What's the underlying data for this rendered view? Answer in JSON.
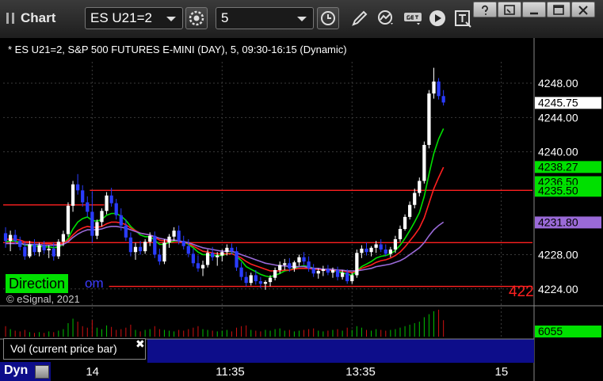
{
  "window": {
    "title": "Chart",
    "symbol": "ES U21=2",
    "interval": "5",
    "controls": [
      "settings-icon",
      "interval-clock-icon",
      "draw-pencil-icon",
      "study-icon",
      "get-data-icon",
      "play-icon",
      "annotation-icon"
    ],
    "window_buttons": [
      "help-icon",
      "restore-icon",
      "minimize-icon",
      "maximize-icon",
      "close-icon"
    ]
  },
  "chart_header": "* ES U21=2, S&P 500 FUTURES E-MINI (DAY), 5, 09:30-16:15 (Dynamic)",
  "overlay": {
    "direction_label": "Direction",
    "direction_tail": "om",
    "copyright": "© eSignal, 2021",
    "right_partial": "422"
  },
  "colors": {
    "background": "#000000",
    "grid": "#3a3a3a",
    "up_candle": "#ffffff",
    "down_candle": "#2a3cff",
    "reference_line": "#ff2020",
    "fast_ma": "#00e000",
    "slow_ma": "#ff2020",
    "vwap_ma": "#9a6ad8",
    "volume_panel": "#0d0d8a",
    "price_tag_green": "#00e000",
    "price_tag_purple": "#9a6ad8"
  },
  "chart_data": {
    "type": "candlestick",
    "y_axis": {
      "ylim": [
        4222.5,
        4250.5
      ],
      "ticks": [
        "4248.00",
        "4244.00",
        "4240.00",
        "4228.00",
        "4224.00"
      ],
      "price_tags": [
        {
          "label": "4245.75",
          "value": 4245.75,
          "style": "white"
        },
        {
          "label": "4238.27",
          "value": 4238.27,
          "style": "green"
        },
        {
          "label": "4236.50",
          "value": 4236.5,
          "style": "green"
        },
        {
          "label": "4235.50",
          "value": 4235.5,
          "style": "green"
        },
        {
          "label": "4231.80",
          "value": 4231.8,
          "style": "purple"
        }
      ]
    },
    "x_axis": {
      "labels": [
        "14",
        "11:35",
        "13:35",
        "15"
      ],
      "label_index": [
        18,
        45,
        72,
        103
      ]
    },
    "reference_lines": [
      {
        "value": 4235.5,
        "from_index": 18,
        "to_index": 110
      },
      {
        "value": 4233.8,
        "from_index": 0,
        "to_index": 21
      },
      {
        "value": 4229.4,
        "from_index": 0,
        "to_index": 110
      },
      {
        "value": 4224.3,
        "from_index": 22,
        "to_index": 110
      }
    ],
    "bar_count": 110,
    "candles": [
      [
        4230.5,
        4231.2,
        4228.8,
        4229.6
      ],
      [
        4229.6,
        4230.8,
        4228.4,
        4230.3
      ],
      [
        4230.3,
        4230.9,
        4229.2,
        4229.6
      ],
      [
        4229.6,
        4230.1,
        4228.5,
        4228.9
      ],
      [
        4228.9,
        4229.5,
        4227.4,
        4227.8
      ],
      [
        4227.8,
        4229.6,
        4227.6,
        4229.2
      ],
      [
        4229.2,
        4229.8,
        4227.9,
        4228.3
      ],
      [
        4228.3,
        4229.4,
        4227.8,
        4229.1
      ],
      [
        4229.1,
        4229.6,
        4228.1,
        4228.5
      ],
      [
        4228.5,
        4229.1,
        4227.6,
        4228.7
      ],
      [
        4228.7,
        4229.4,
        4227.3,
        4227.8
      ],
      [
        4227.8,
        4229.8,
        4227.5,
        4229.5
      ],
      [
        4229.5,
        4230.8,
        4229.0,
        4230.4
      ],
      [
        4230.4,
        4234.1,
        4230.1,
        4233.7
      ],
      [
        4233.7,
        4236.6,
        4233.0,
        4236.2
      ],
      [
        4236.2,
        4237.4,
        4235.0,
        4235.5
      ],
      [
        4235.5,
        4236.1,
        4233.6,
        4234.1
      ],
      [
        4234.1,
        4234.8,
        4232.4,
        4233.0
      ],
      [
        4233.0,
        4235.4,
        4229.4,
        4230.2
      ],
      [
        4230.2,
        4232.1,
        4229.8,
        4231.8
      ],
      [
        4231.8,
        4233.4,
        4231.3,
        4233.1
      ],
      [
        4233.1,
        4235.3,
        4232.7,
        4234.9
      ],
      [
        4234.9,
        4235.8,
        4233.6,
        4234.0
      ],
      [
        4234.0,
        4234.5,
        4232.1,
        4232.6
      ],
      [
        4232.6,
        4233.4,
        4230.8,
        4231.4
      ],
      [
        4231.4,
        4232.1,
        4229.6,
        4230.0
      ],
      [
        4230.0,
        4230.6,
        4227.8,
        4228.3
      ],
      [
        4228.3,
        4229.4,
        4227.4,
        4228.9
      ],
      [
        4228.9,
        4229.6,
        4228.0,
        4228.4
      ],
      [
        4228.4,
        4229.8,
        4228.1,
        4229.5
      ],
      [
        4229.5,
        4230.6,
        4229.0,
        4230.2
      ],
      [
        4230.2,
        4230.7,
        4227.6,
        4228.0
      ],
      [
        4228.0,
        4228.7,
        4226.8,
        4227.2
      ],
      [
        4227.2,
        4229.8,
        4226.9,
        4229.4
      ],
      [
        4229.4,
        4230.4,
        4228.8,
        4230.1
      ],
      [
        4230.1,
        4231.2,
        4229.6,
        4230.8
      ],
      [
        4230.8,
        4231.4,
        4229.2,
        4229.6
      ],
      [
        4229.6,
        4230.2,
        4228.6,
        4229.0
      ],
      [
        4229.0,
        4229.8,
        4227.7,
        4228.1
      ],
      [
        4228.1,
        4228.7,
        4226.6,
        4227.0
      ],
      [
        4227.0,
        4227.9,
        4226.0,
        4226.4
      ],
      [
        4226.4,
        4227.3,
        4225.5,
        4226.8
      ],
      [
        4226.8,
        4228.6,
        4226.5,
        4228.2
      ],
      [
        4228.2,
        4228.9,
        4227.3,
        4227.7
      ],
      [
        4227.7,
        4228.3,
        4226.7,
        4227.9
      ],
      [
        4227.9,
        4228.6,
        4227.2,
        4228.3
      ],
      [
        4228.3,
        4229.2,
        4227.9,
        4228.8
      ],
      [
        4228.8,
        4229.3,
        4228.0,
        4228.4
      ],
      [
        4228.4,
        4228.9,
        4226.1,
        4226.5
      ],
      [
        4226.5,
        4227.1,
        4225.0,
        4225.4
      ],
      [
        4225.4,
        4226.0,
        4224.3,
        4224.7
      ],
      [
        4224.7,
        4225.9,
        4224.4,
        4225.6
      ],
      [
        4225.6,
        4226.2,
        4224.5,
        4224.9
      ],
      [
        4224.9,
        4225.4,
        4224.1,
        4224.6
      ],
      [
        4224.6,
        4225.0,
        4223.9,
        4224.8
      ],
      [
        4224.8,
        4225.6,
        4224.3,
        4225.3
      ],
      [
        4225.3,
        4226.5,
        4225.0,
        4226.2
      ],
      [
        4226.2,
        4227.2,
        4225.8,
        4226.8
      ],
      [
        4226.8,
        4227.5,
        4226.2,
        4227.0
      ],
      [
        4227.0,
        4227.6,
        4226.0,
        4226.4
      ],
      [
        4226.4,
        4227.3,
        4226.0,
        4227.1
      ],
      [
        4227.1,
        4228.0,
        4226.7,
        4227.7
      ],
      [
        4227.7,
        4228.3,
        4226.8,
        4227.2
      ],
      [
        4227.2,
        4227.8,
        4226.0,
        4226.4
      ],
      [
        4226.4,
        4226.9,
        4225.4,
        4225.8
      ],
      [
        4225.8,
        4226.4,
        4225.2,
        4226.1
      ],
      [
        4226.1,
        4226.7,
        4225.5,
        4226.3
      ],
      [
        4226.3,
        4226.8,
        4225.6,
        4225.9
      ],
      [
        4225.9,
        4226.5,
        4225.3,
        4226.2
      ],
      [
        4226.2,
        4226.6,
        4225.0,
        4225.4
      ],
      [
        4225.4,
        4226.2,
        4225.1,
        4225.9
      ],
      [
        4225.9,
        4226.3,
        4224.6,
        4224.9
      ],
      [
        4224.9,
        4225.9,
        4224.6,
        4225.6
      ],
      [
        4225.6,
        4228.6,
        4225.3,
        4228.2
      ],
      [
        4228.2,
        4229.1,
        4227.6,
        4228.7
      ],
      [
        4228.7,
        4229.4,
        4227.9,
        4228.3
      ],
      [
        4228.3,
        4229.0,
        4227.8,
        4228.8
      ],
      [
        4228.8,
        4229.6,
        4228.2,
        4229.2
      ],
      [
        4229.2,
        4229.8,
        4228.3,
        4228.6
      ],
      [
        4228.6,
        4229.2,
        4227.8,
        4228.1
      ],
      [
        4228.1,
        4228.9,
        4227.7,
        4228.6
      ],
      [
        4228.6,
        4230.2,
        4228.2,
        4229.8
      ],
      [
        4229.8,
        4231.4,
        4229.5,
        4231.0
      ],
      [
        4231.0,
        4232.7,
        4230.8,
        4232.4
      ],
      [
        4232.4,
        4234.2,
        4232.1,
        4233.8
      ],
      [
        4233.8,
        4235.7,
        4233.4,
        4235.2
      ],
      [
        4235.2,
        4237.0,
        4234.8,
        4236.6
      ],
      [
        4236.6,
        4241.2,
        4236.3,
        4240.8
      ],
      [
        4240.8,
        4247.2,
        4240.4,
        4246.8
      ],
      [
        4246.8,
        4249.8,
        4246.2,
        4248.2
      ],
      [
        4248.2,
        4248.6,
        4246.1,
        4246.5
      ],
      [
        4246.5,
        4247.2,
        4245.4,
        4245.75
      ]
    ],
    "series": [
      {
        "name": "",
        "color": "#00e000",
        "values": [
          4229.5,
          4229.6,
          4229.6,
          4229.4,
          4229.1,
          4229.1,
          4229.0,
          4229.0,
          4228.9,
          4228.9,
          4228.8,
          4228.9,
          4229.2,
          4229.9,
          4231.0,
          4231.8,
          4232.2,
          4232.4,
          4232.0,
          4231.9,
          4232.1,
          4232.6,
          4232.8,
          4232.8,
          4232.5,
          4232.0,
          4231.3,
          4230.8,
          4230.3,
          4230.1,
          4230.1,
          4229.7,
          4229.2,
          4229.2,
          4229.4,
          4229.6,
          4229.6,
          4229.5,
          4229.2,
          4228.8,
          4228.3,
          4228.0,
          4228.0,
          4227.9,
          4227.9,
          4227.9,
          4228.1,
          4228.2,
          4227.8,
          4227.3,
          4226.6,
          4226.3,
          4226.0,
          4225.7,
          4225.5,
          4225.4,
          4225.6,
          4225.8,
          4226.1,
          4226.2,
          4226.4,
          4226.6,
          4226.7,
          4226.6,
          4226.4,
          4226.3,
          4226.3,
          4226.2,
          4226.2,
          4226.0,
          4225.9,
          4225.7,
          4225.6,
          4226.1,
          4226.6,
          4226.9,
          4227.2,
          4227.6,
          4227.8,
          4227.9,
          4228.1,
          4228.5,
          4229.1,
          4229.9,
          4230.8,
          4231.8,
          4232.9,
          4234.8,
          4237.4,
          4239.8,
          4241.5,
          4242.7
        ]
      },
      {
        "name": "",
        "color": "#ff2020",
        "values": [
          4229.8,
          4229.8,
          4229.8,
          4229.7,
          4229.5,
          4229.5,
          4229.4,
          4229.4,
          4229.3,
          4229.3,
          4229.2,
          4229.2,
          4229.3,
          4229.7,
          4230.3,
          4230.8,
          4231.1,
          4231.3,
          4231.2,
          4231.2,
          4231.3,
          4231.6,
          4231.8,
          4231.8,
          4231.7,
          4231.5,
          4231.1,
          4230.8,
          4230.5,
          4230.4,
          4230.3,
          4230.0,
          4229.7,
          4229.6,
          4229.6,
          4229.7,
          4229.6,
          4229.5,
          4229.3,
          4229.0,
          4228.7,
          4228.4,
          4228.3,
          4228.2,
          4228.1,
          4228.1,
          4228.1,
          4228.1,
          4227.9,
          4227.6,
          4227.2,
          4226.9,
          4226.7,
          4226.5,
          4226.3,
          4226.1,
          4226.1,
          4226.1,
          4226.2,
          4226.2,
          4226.3,
          4226.4,
          4226.4,
          4226.4,
          4226.3,
          4226.3,
          4226.2,
          4226.2,
          4226.2,
          4226.1,
          4226.1,
          4226.0,
          4225.9,
          4226.1,
          4226.4,
          4226.6,
          4226.8,
          4227.1,
          4227.3,
          4227.4,
          4227.6,
          4227.9,
          4228.3,
          4228.9,
          4229.6,
          4230.3,
          4231.1,
          4232.3,
          4234.0,
          4235.7,
          4237.0,
          4238.2
        ]
      },
      {
        "name": "",
        "color": "#9a6ad8",
        "values": [
          4229.3,
          4229.3,
          4229.3,
          4229.3,
          4229.2,
          4229.2,
          4229.2,
          4229.2,
          4229.1,
          4229.1,
          4229.1,
          4229.1,
          4229.2,
          4229.5,
          4230.0,
          4230.4,
          4230.7,
          4230.9,
          4230.9,
          4230.9,
          4231.0,
          4231.2,
          4231.3,
          4231.3,
          4231.2,
          4231.1,
          4230.9,
          4230.7,
          4230.5,
          4230.4,
          4230.3,
          4230.1,
          4229.9,
          4229.8,
          4229.7,
          4229.7,
          4229.6,
          4229.5,
          4229.4,
          4229.2,
          4229.0,
          4228.8,
          4228.7,
          4228.6,
          4228.5,
          4228.4,
          4228.4,
          4228.4,
          4228.2,
          4228.0,
          4227.8,
          4227.6,
          4227.4,
          4227.2,
          4227.0,
          4226.9,
          4226.8,
          4226.7,
          4226.7,
          4226.6,
          4226.6,
          4226.6,
          4226.6,
          4226.5,
          4226.4,
          4226.4,
          4226.3,
          4226.3,
          4226.3,
          4226.2,
          4226.2,
          4226.1,
          4226.1,
          4226.1,
          4226.2,
          4226.3,
          4226.4,
          4226.6,
          4226.7,
          4226.8,
          4226.9,
          4227.1,
          4227.3,
          4227.6,
          4228.0,
          4228.4,
          4228.8,
          4229.4,
          4230.2,
          4230.9,
          4231.4,
          4231.8
        ]
      }
    ],
    "volume": {
      "label": "Vol (current price bar)",
      "last_tag": "6055",
      "values": [
        14,
        10,
        8,
        7,
        9,
        6,
        5,
        6,
        5,
        7,
        6,
        8,
        10,
        18,
        24,
        20,
        14,
        12,
        22,
        12,
        10,
        15,
        13,
        9,
        10,
        12,
        16,
        9,
        7,
        9,
        10,
        14,
        10,
        9,
        8,
        7,
        9,
        8,
        10,
        12,
        14,
        10,
        9,
        8,
        7,
        8,
        9,
        7,
        12,
        14,
        15,
        9,
        8,
        7,
        9,
        8,
        10,
        11,
        8,
        9,
        7,
        8,
        9,
        10,
        11,
        8,
        7,
        8,
        9,
        10,
        8,
        12,
        9,
        14,
        12,
        9,
        8,
        10,
        9,
        8,
        9,
        10,
        12,
        14,
        16,
        18,
        20,
        26,
        30,
        34,
        36,
        22
      ]
    }
  }
}
